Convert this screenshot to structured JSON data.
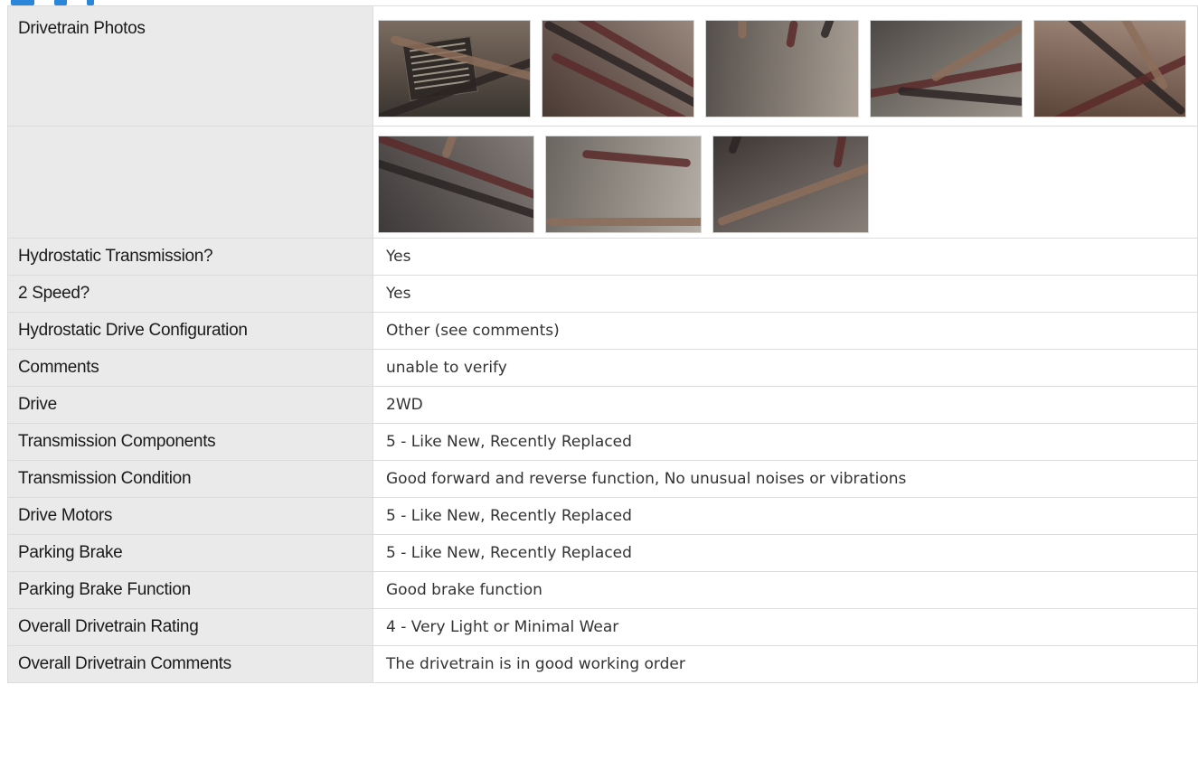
{
  "section": {
    "photos_label": "Drivetrain Photos",
    "photo_icons": [
      "photo-thumbnail-icon"
    ]
  },
  "photos_row1": [
    {
      "name": "drivetrain-photo-1"
    },
    {
      "name": "drivetrain-photo-2"
    },
    {
      "name": "drivetrain-photo-3"
    },
    {
      "name": "drivetrain-photo-4"
    },
    {
      "name": "drivetrain-photo-5"
    }
  ],
  "photos_row2": [
    {
      "name": "drivetrain-photo-6"
    },
    {
      "name": "drivetrain-photo-7"
    },
    {
      "name": "drivetrain-photo-8"
    }
  ],
  "rows": [
    {
      "label": "Hydrostatic Transmission?",
      "value": "Yes"
    },
    {
      "label": "2 Speed?",
      "value": "Yes"
    },
    {
      "label": "Hydrostatic Drive Configuration",
      "value": "Other (see comments)"
    },
    {
      "label": "Comments",
      "value": "unable to verify"
    },
    {
      "label": "Drive",
      "value": "2WD"
    },
    {
      "label": "Transmission Components",
      "value": "5 - Like New, Recently Replaced"
    },
    {
      "label": "Transmission Condition",
      "value": "Good forward and reverse function, No unusual noises or vibrations"
    },
    {
      "label": "Drive Motors",
      "value": "5 - Like New, Recently Replaced"
    },
    {
      "label": "Parking Brake",
      "value": "5 - Like New, Recently Replaced"
    },
    {
      "label": "Parking Brake Function",
      "value": "Good brake function"
    },
    {
      "label": "Overall Drivetrain Rating",
      "value": "4 - Very Light or Minimal Wear"
    },
    {
      "label": "Overall Drivetrain Comments",
      "value": "The drivetrain is in good working order"
    }
  ],
  "colors": {
    "accent": "#2a86d8",
    "label_bg": "#eaeaea",
    "border": "#dcdcdc"
  }
}
